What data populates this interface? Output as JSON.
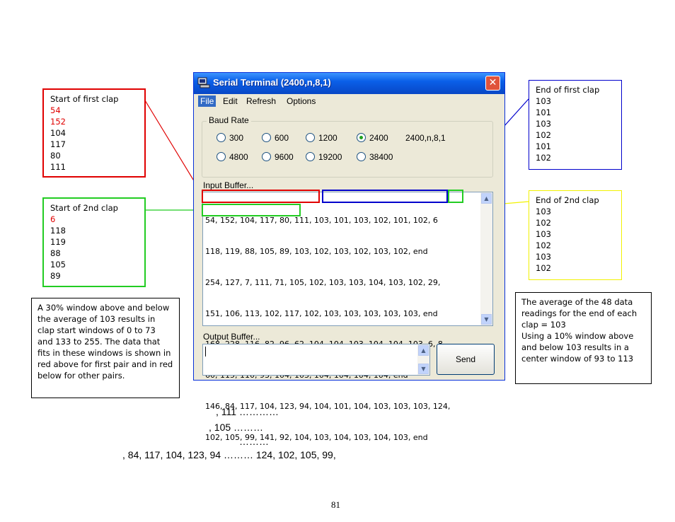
{
  "window": {
    "title": "Serial Terminal (2400,n,8,1)",
    "close_glyph": "✕",
    "menu": [
      "File",
      "Edit",
      "Refresh",
      "Options"
    ],
    "baud_rate_label": "Baud Rate",
    "baud_options_row1": [
      "300",
      "600",
      "1200",
      "2400"
    ],
    "baud_options_row2": [
      "4800",
      "9600",
      "19200",
      "38400"
    ],
    "selected_baud": "2400",
    "status_text": "2400,n,8,1",
    "input_buffer_label": "Input Buffer...",
    "input_buffer_lines": [
      "54, 152, 104, 117, 80, 111, 103, 101, 103, 102, 101, 102, 6",
      "118, 119, 88, 105, 89, 103, 102, 103, 102, 103, 102, end",
      "254, 127, 7, 111, 71, 105, 102, 103, 103, 104, 103, 102, 29,",
      "151, 106, 113, 102, 117, 102, 103, 103, 103, 103, 103, end",
      "168, 228, 116, 82, 96, 62, 104, 104, 103, 104, 104, 103, 6, 8,",
      "60, 115, 110, 93, 104, 103, 104, 104, 104, 104, end",
      "146, 84, 117, 104, 123, 94, 104, 101, 104, 103, 103, 103, 124,",
      "102, 105, 99, 141, 92, 104, 103, 104, 103, 104, 103, end"
    ],
    "output_buffer_label": "Output Buffer...",
    "send_label": "Send"
  },
  "notes": {
    "start_first_clap": {
      "title": "Start of first clap",
      "values_red": [
        "54",
        "152"
      ],
      "values": [
        "104",
        "117",
        "80",
        "111"
      ]
    },
    "start_second_clap": {
      "title": "Start of 2nd clap",
      "values_red": [
        "6"
      ],
      "values": [
        "118",
        "119",
        "88",
        "105",
        "89"
      ]
    },
    "end_first_clap": {
      "title": "End of first clap",
      "values": [
        "103",
        "101",
        "103",
        "102",
        "101",
        "102"
      ]
    },
    "end_second_clap": {
      "title": "End of 2nd clap",
      "values": [
        "103",
        "102",
        "103",
        "102",
        "103",
        "102"
      ]
    },
    "window_30": "A 30% window above and below the average of 103 results in clap start windows of 0 to 73 and 133 to 255. The data that fits in these windows is shown in red above for first pair and in red below for other pairs.",
    "window_10": "The average of the 48 data readings for the end of each clap = 103\nUsing a 10% window above and below 103 results in a center window of 93 to 113"
  },
  "footer_lines": [
    ", 111 …………",
    ", 105 ………",
    "………",
    ", 84, 117, 104, 123, 94 ……… 124, 102, 105, 99,"
  ],
  "page_number": "81",
  "colors": {
    "red": "#e00000",
    "green": "#22cc22",
    "blue": "#0000cc",
    "yellow": "#f2f200",
    "xp_blue": "#0a5fe8"
  }
}
